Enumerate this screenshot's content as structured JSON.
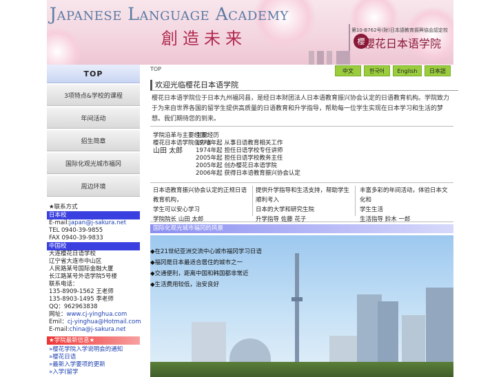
{
  "banner": {
    "title": "Japanese Language Academy",
    "slogan": "創造未来",
    "cert": "第10-B762号(財)日本語教育振興協会認定校",
    "school": "櫻花日本语学院",
    "seal_glyph": "櫻"
  },
  "sidebar": {
    "top_label": "TOP",
    "items": [
      {
        "label": "3项特点&学校的课程"
      },
      {
        "label": "年间活动"
      },
      {
        "label": "招生简章"
      },
      {
        "label": "国际化观光城市福冈"
      },
      {
        "label": "周边环境"
      }
    ],
    "contact_title": "★联系方式",
    "japan_head": "日本校",
    "japan_email_prefix": "E-mail:",
    "japan_email": "japan@j-sakura.net",
    "japan_tel": "TEL 0940-39-9855",
    "japan_fax": "FAX 0940-39-9833",
    "china_head": "中国校",
    "china_lines": [
      "大连樱花日语学校",
      "辽宁省大连市中山区",
      "人民路某号国际金融大厦",
      "长江路某号外语学院5号楼",
      "联系电话："
    ],
    "china_phone1": "135-8909-1562",
    "china_phone1_name": "王老师",
    "china_phone2": "135-8903-1495",
    "china_phone2_name": "李老师",
    "qq": "QQ：962963838",
    "url_prefix": "网址：",
    "url": "www.cj-yinghua.com",
    "emil_prefix": "Emil：",
    "emil": "cj-yinghua@Hotmail.com",
    "china_email_prefix": "E-mail:",
    "china_email": "china@j-sakura.net",
    "notice_head": "★学院最新信息★",
    "notices": [
      "»樱花学院入学说明会的通知",
      "»樱花日语",
      "»最新入学要项的更新",
      "»入学(留学"
    ]
  },
  "main": {
    "breadcrumb": "TOP",
    "langs": [
      "中文",
      "한국어",
      "English",
      "日本語"
    ],
    "heading": "欢迎光临樱花日本语学院",
    "intro": "樱花日本语学院位于日本九州福冈县，是经日本财团法人日本语教育振兴协会认定的日语教育机构。学院致力于为来自世界各国的留学生提供高质量的日语教育和升学指导，帮助每一位学生实现在日本学习和生活的梦想。我们期待您的到来。",
    "history_label": "学院沿革与主要经历：",
    "history_sub": "樱花日本语学院创办者",
    "history_name": "山田 太郎",
    "history_col_head": "主要经历",
    "history": [
      "1973年起 从事日语教育相关工作",
      "1974年起 担任日语学校专任讲师",
      "2005年起 担任日语学校教务主任",
      "2005年起 创办樱花日本语学院",
      "2006年起 获得日本语教育振兴协会认定"
    ],
    "col1": [
      "日本语教育振兴协会认定的正规日语教育机构，",
      "学生可以安心学习",
      "学院院长 山田 太郎"
    ],
    "col2": [
      "提供升学指导和生活支持，帮助学生顺利考入",
      "日本的大学和研究生院",
      "升学指导 佐藤 花子"
    ],
    "col3": [
      "丰富多彩的年间活动，体验日本文化和",
      "学生生活",
      "生活指导 鈴木 一郎"
    ],
    "photo_head": "国际化观光城市福冈的风景",
    "bullets": [
      "◆在21世纪亚洲交流中心城市福冈学习日语",
      "◆福冈是日本最适合居住的城市之一",
      "◆交通便利，距离中国和韩国都非常近",
      "◆生活费用较低，治安良好"
    ]
  },
  "colors": {
    "accent_blue": "#3a3fe0",
    "lang_green": "#9acc3e",
    "banner_pink": "#f3d5df",
    "school_red": "#8a1838"
  }
}
